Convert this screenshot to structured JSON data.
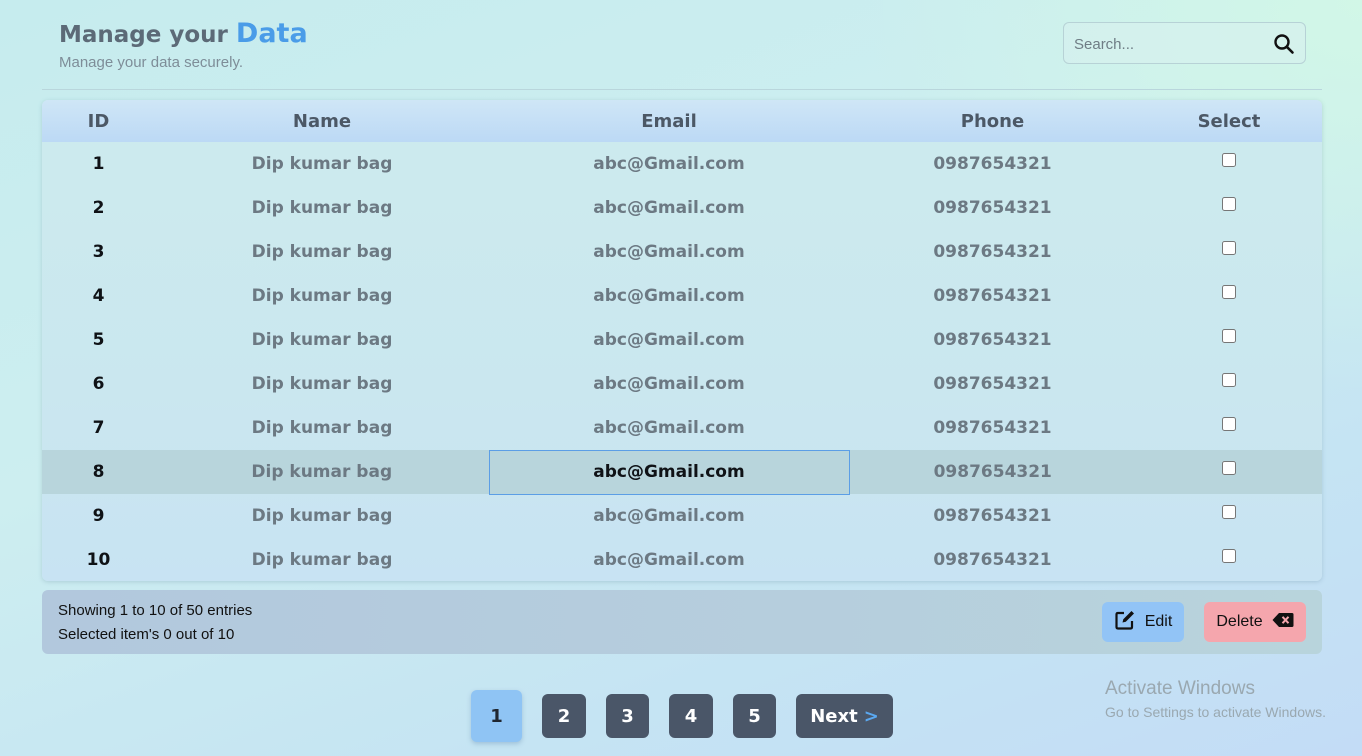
{
  "header": {
    "title_prefix": "Manage your",
    "title_accent": "Data",
    "subtitle": "Manage your data securely."
  },
  "search": {
    "placeholder": "Search...",
    "value": "",
    "icon": "search-icon"
  },
  "table": {
    "columns": [
      "ID",
      "Name",
      "Email",
      "Phone",
      "Select"
    ],
    "rows": [
      {
        "id": "1",
        "name": "Dip kumar bag",
        "email": "abc@Gmail.com",
        "phone": "0987654321"
      },
      {
        "id": "2",
        "name": "Dip kumar bag",
        "email": "abc@Gmail.com",
        "phone": "0987654321"
      },
      {
        "id": "3",
        "name": "Dip kumar bag",
        "email": "abc@Gmail.com",
        "phone": "0987654321"
      },
      {
        "id": "4",
        "name": "Dip kumar bag",
        "email": "abc@Gmail.com",
        "phone": "0987654321"
      },
      {
        "id": "5",
        "name": "Dip kumar bag",
        "email": "abc@Gmail.com",
        "phone": "0987654321"
      },
      {
        "id": "6",
        "name": "Dip kumar bag",
        "email": "abc@Gmail.com",
        "phone": "0987654321"
      },
      {
        "id": "7",
        "name": "Dip kumar bag",
        "email": "abc@Gmail.com",
        "phone": "0987654321"
      },
      {
        "id": "8",
        "name": "Dip kumar bag",
        "email": "abc@Gmail.com",
        "phone": "0987654321"
      },
      {
        "id": "9",
        "name": "Dip kumar bag",
        "email": "abc@Gmail.com",
        "phone": "0987654321"
      },
      {
        "id": "10",
        "name": "Dip kumar bag",
        "email": "abc@Gmail.com",
        "phone": "0987654321"
      }
    ]
  },
  "footer": {
    "showing": "Showing 1 to 10 of 50 entries",
    "selected": "Selected item's 0 out of 10",
    "edit_label": "Edit",
    "delete_label": "Delete"
  },
  "pagination": {
    "pages": [
      "1",
      "2",
      "3",
      "4",
      "5"
    ],
    "current": "1",
    "next_label": "Next",
    "next_arrow": ">"
  },
  "watermark": {
    "line1": "Activate Windows",
    "line2": "Go to Settings to activate Windows."
  },
  "colors": {
    "accent": "#4a9ce8",
    "edit_button": "#92c4f6",
    "delete_button": "#f5a6ad",
    "page_button": "#4a5668",
    "current_page": "#8fc4f4"
  }
}
